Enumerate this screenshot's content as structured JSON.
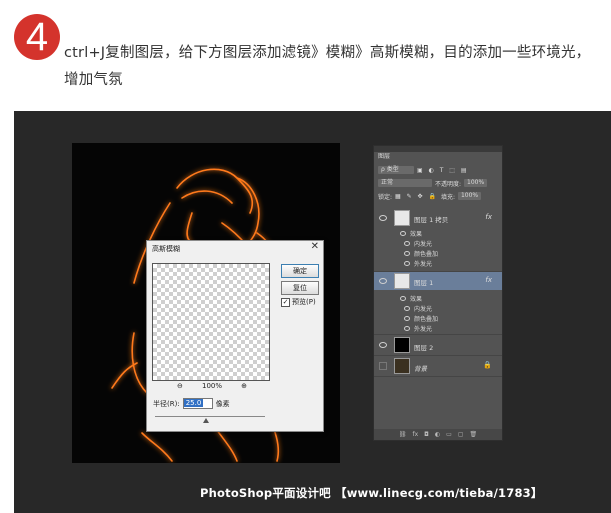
{
  "step": {
    "number": "4",
    "text": "ctrl+J复制图层，给下方图层添加滤镜》模糊》高斯模糊，目的添加一些环境光，增加气氛"
  },
  "dialog": {
    "title": "高斯模糊",
    "close": "✕",
    "ok_label": "确定",
    "reset_label": "复位",
    "preview_label": "预览(P)",
    "preview_checked": "✓",
    "zoom_out": "⊖",
    "zoom_level": "100%",
    "zoom_in": "⊕",
    "radius_label": "半径(R):",
    "radius_value": "25.0",
    "radius_unit": "像素"
  },
  "layers_panel": {
    "tab": "图层",
    "kind_filter": "ρ 类型",
    "blend_mode": "正常",
    "opacity_label": "不透明度:",
    "opacity_value": "100%",
    "lock_label": "锁定:",
    "fill_label": "填充:",
    "fill_value": "100%",
    "layers": [
      {
        "name": "图层 1 拷贝",
        "fx": "fx",
        "effects_label": "效果",
        "effects": [
          "内发光",
          "颜色叠加",
          "外发光"
        ]
      },
      {
        "name": "图层 1",
        "fx": "fx",
        "effects_label": "效果",
        "effects": [
          "内发光",
          "颜色叠加",
          "外发光"
        ]
      },
      {
        "name": "图层 2"
      },
      {
        "name": "背景",
        "locked": "🔒"
      }
    ],
    "bottom_icons": [
      "link-icon",
      "fx-icon",
      "mask-icon",
      "adjustment-icon",
      "group-icon",
      "new-layer-icon",
      "trash-icon"
    ]
  },
  "watermark": "PhotoShop平面设计吧 【www.linecg.com/tieba/1783】",
  "colors": {
    "badge": "#d4332c",
    "glow": "#ff6a00",
    "selected_layer": "#6a7e9a"
  }
}
